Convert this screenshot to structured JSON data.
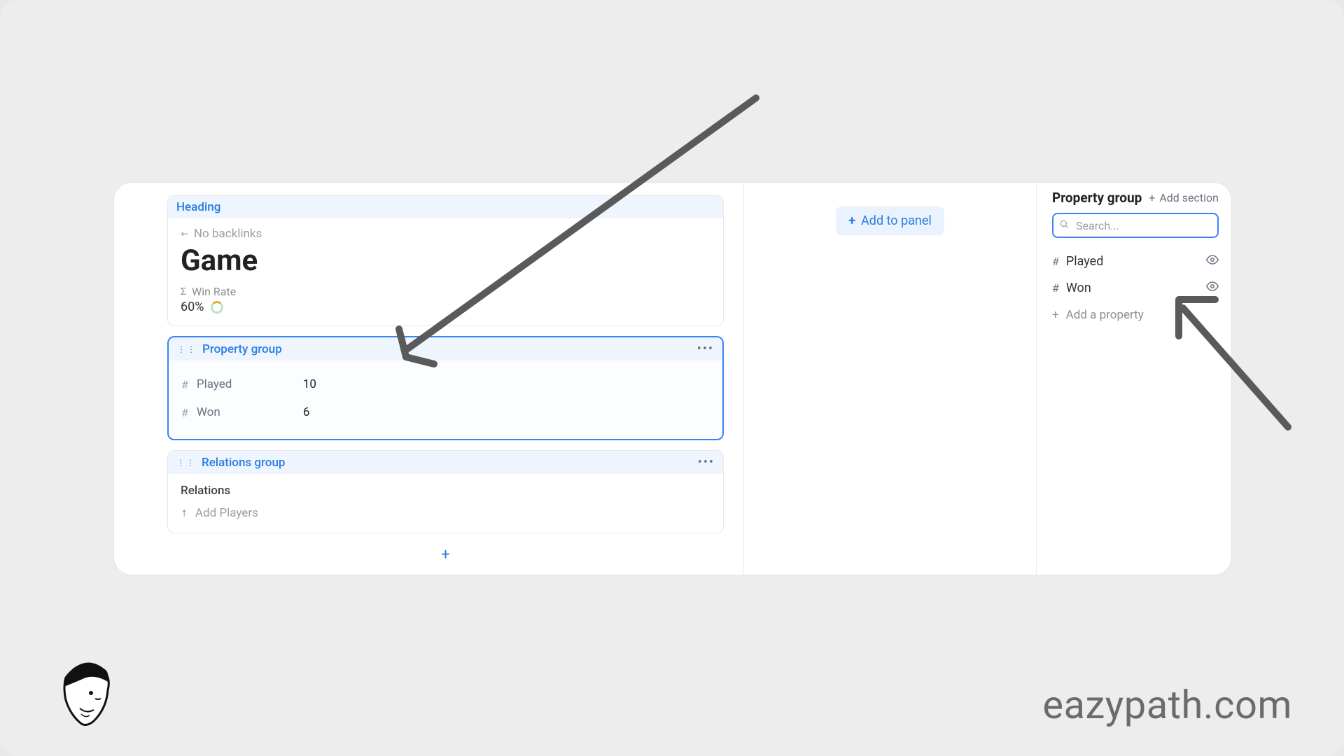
{
  "heading": {
    "section_label": "Heading",
    "no_backlinks": "No backlinks",
    "title": "Game",
    "winrate_label": "Win Rate",
    "winrate_value": "60%"
  },
  "property_group": {
    "section_label": "Property group",
    "rows": [
      {
        "icon": "#",
        "label": "Played",
        "value": "10"
      },
      {
        "icon": "#",
        "label": "Won",
        "value": "6"
      }
    ]
  },
  "relations_group": {
    "section_label": "Relations group",
    "title": "Relations",
    "add_label": "Add Players"
  },
  "add_to_panel": "Add to panel",
  "side_panel": {
    "title": "Property group",
    "add_section": "Add section",
    "search_placeholder": "Search...",
    "props": [
      {
        "label": "Played"
      },
      {
        "label": "Won"
      }
    ],
    "add_property": "Add a property"
  },
  "brand": "eazypath.com"
}
